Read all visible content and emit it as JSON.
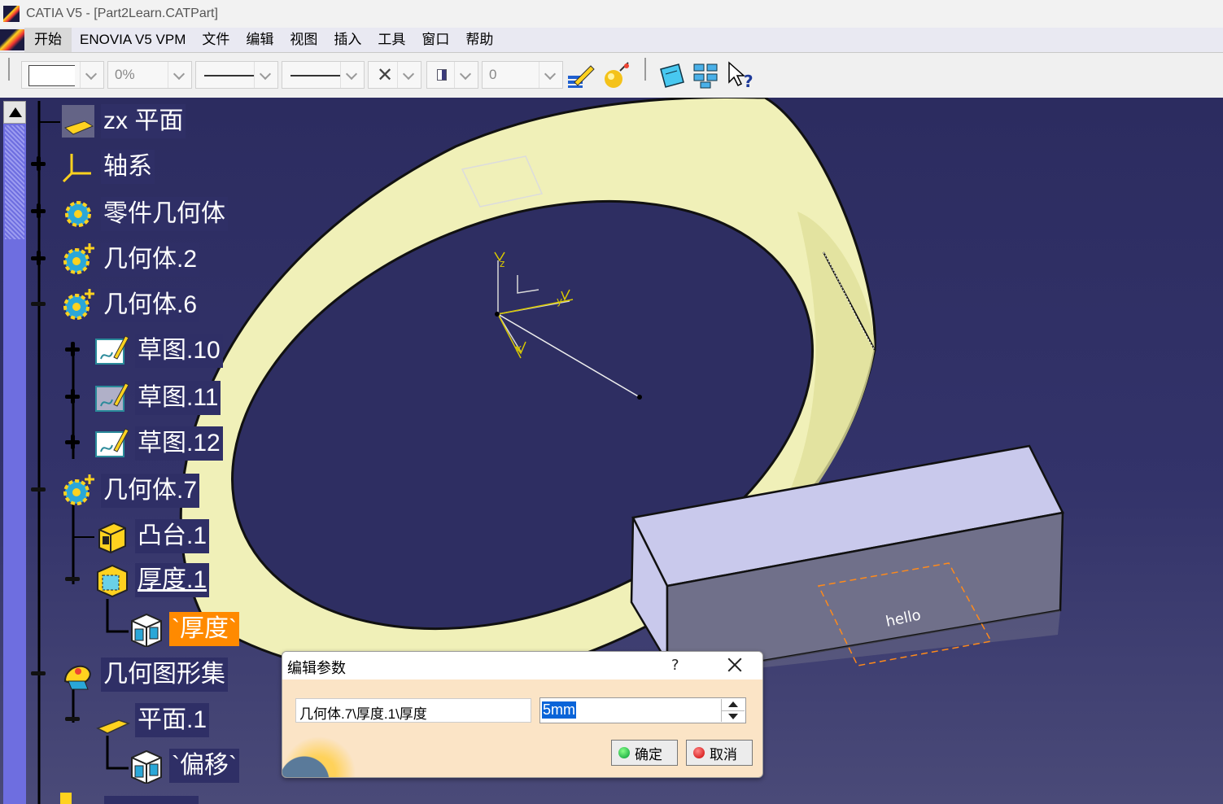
{
  "window": {
    "title": "CATIA V5 - [Part2Learn.CATPart]"
  },
  "menu": {
    "items": [
      "开始",
      "ENOVIA V5 VPM",
      "文件",
      "编辑",
      "视图",
      "插入",
      "工具",
      "窗口",
      "帮助"
    ]
  },
  "toolbar": {
    "transparency": "0%",
    "layer_value": "0"
  },
  "tree": {
    "nodes": [
      {
        "label": "zx 平面"
      },
      {
        "label": "轴系"
      },
      {
        "label": "零件几何体"
      },
      {
        "label": "几何体.2"
      },
      {
        "label": "几何体.6"
      },
      {
        "label": "草图.10"
      },
      {
        "label": "草图.11"
      },
      {
        "label": "草图.12"
      },
      {
        "label": "几何体.7"
      },
      {
        "label": "凸台.1"
      },
      {
        "label": "厚度.1"
      },
      {
        "label": "`厚度`"
      },
      {
        "label": "几何图形集"
      },
      {
        "label": "平面.1"
      },
      {
        "label": "`偏移`"
      }
    ]
  },
  "scene": {
    "text_on_face": "hello",
    "axis_labels": {
      "z": "z",
      "y": "y",
      "x": "x"
    },
    "colors": {
      "cylinder": "#f0f0b8",
      "box_top": "#c9c9ec",
      "box_front": "#70708a",
      "sketch_dashed": "#ff8a1a"
    }
  },
  "dialog": {
    "title": "编辑参数",
    "help": "?",
    "parameter_path": "几何体.7\\厚度.1\\厚度",
    "value": "5mm",
    "ok_label": "确定",
    "cancel_label": "取消"
  }
}
